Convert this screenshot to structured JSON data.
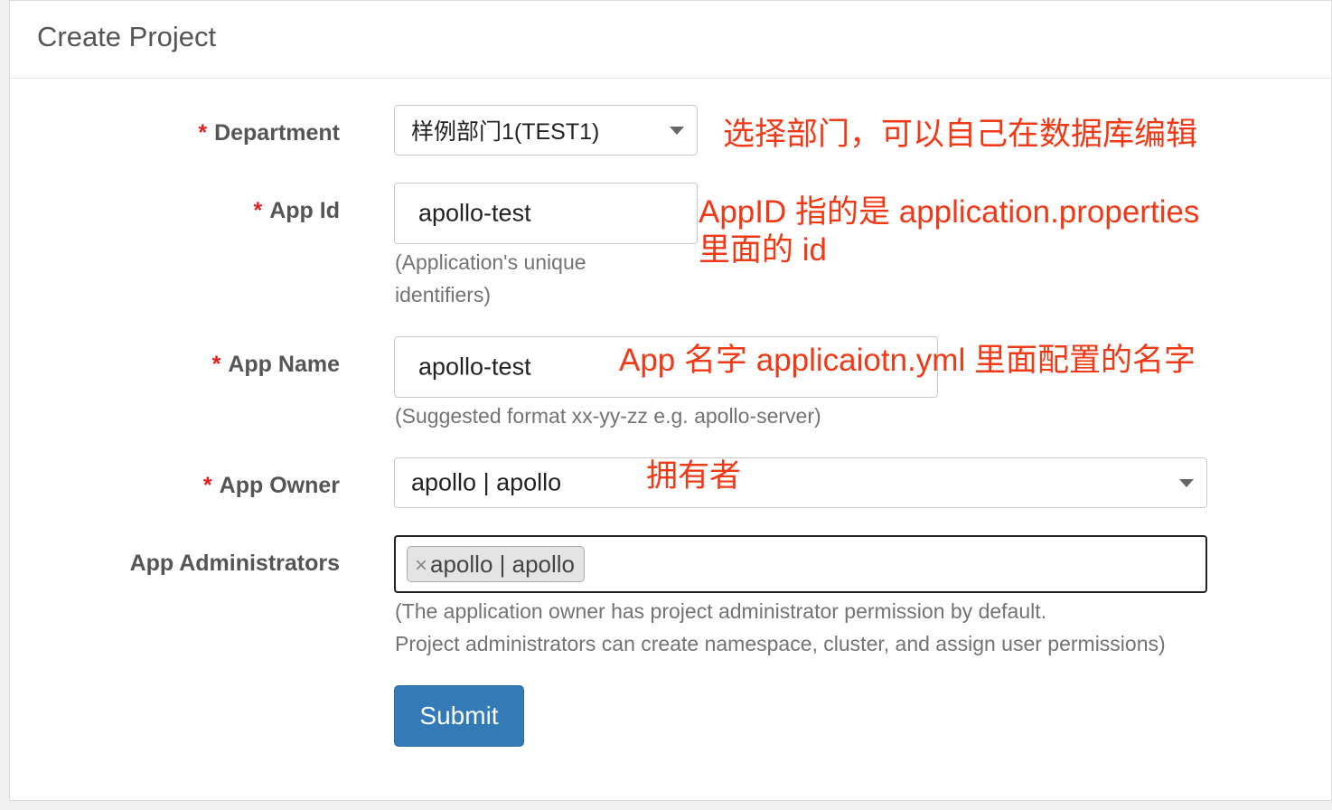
{
  "header": {
    "title": "Create Project"
  },
  "form": {
    "department": {
      "required": "*",
      "label": "Department",
      "value": "样例部门1(TEST1)"
    },
    "app_id": {
      "required": "*",
      "label": "App Id",
      "value": "apollo-test",
      "help_line1": "(Application's unique",
      "help_line2": "identifiers)"
    },
    "app_name": {
      "required": "*",
      "label": "App Name",
      "value": "apollo-test",
      "help": "(Suggested format xx-yy-zz e.g. apollo-server)"
    },
    "app_owner": {
      "required": "*",
      "label": "App Owner",
      "value": "apollo | apollo"
    },
    "app_admins": {
      "label": "App Administrators",
      "tags": [
        {
          "remove": "×",
          "text": "apollo | apollo"
        }
      ],
      "help_line1": "(The application owner has project administrator permission by default.",
      "help_line2": "Project administrators can create namespace, cluster, and assign user permissions)"
    },
    "submit_label": "Submit"
  },
  "annotations": {
    "department": "选择部门，可以自己在数据库编辑",
    "app_id_line1": "AppID 指的是 application.properties",
    "app_id_line2": "里面的 id",
    "app_name": "App 名字 applicaiotn.yml 里面配置的名字",
    "app_owner": "拥有者"
  },
  "colors": {
    "annotation": "#f03a17",
    "required": "#e02020",
    "submit": "#337ab7"
  },
  "icons": {
    "select_caret": "chevron-down-icon",
    "tag_remove": "close-icon"
  }
}
